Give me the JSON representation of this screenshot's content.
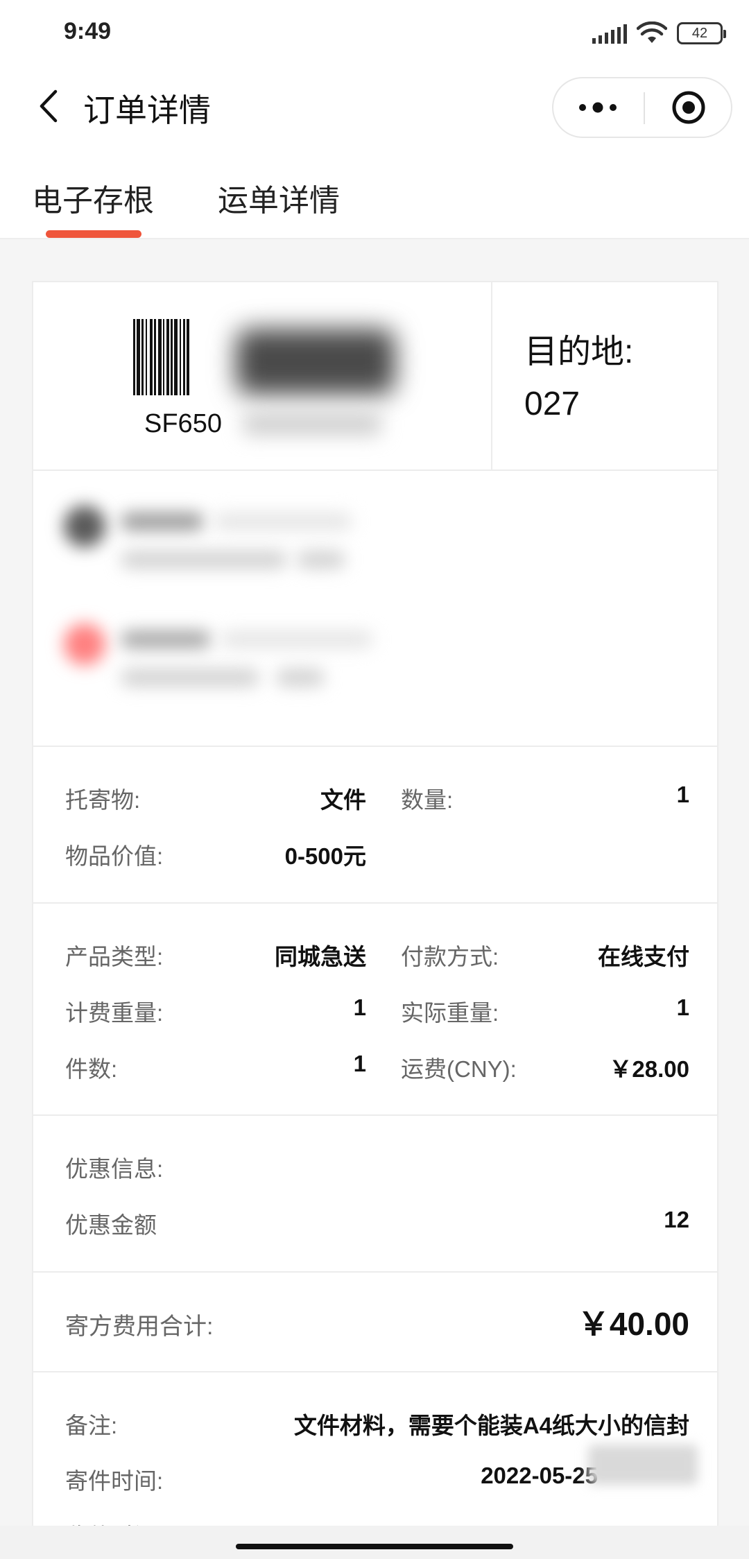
{
  "status_bar": {
    "time": "9:49",
    "battery": "42"
  },
  "nav": {
    "title": "订单详情"
  },
  "tabs": [
    {
      "label": "电子存根",
      "active": true
    },
    {
      "label": "运单详情",
      "active": false
    }
  ],
  "accent_color": "#ef553b",
  "stub": {
    "waybill_prefix": "SF650",
    "destination_label": "目的地:",
    "destination_code": "027"
  },
  "goods": {
    "item_label": "托寄物:",
    "item_value": "文件",
    "quantity_label": "数量:",
    "quantity_value": "1",
    "value_label": "物品价值:",
    "value_value": "0-500元"
  },
  "service": {
    "product_label": "产品类型:",
    "product_value": "同城急送",
    "payment_label": "付款方式:",
    "payment_value": "在线支付",
    "billing_weight_label": "计费重量:",
    "billing_weight_value": "1",
    "actual_weight_label": "实际重量:",
    "actual_weight_value": "1",
    "pieces_label": "件数:",
    "pieces_value": "1",
    "freight_label": "运费(CNY):",
    "freight_value": "￥28.00"
  },
  "discount": {
    "info_label": "优惠信息:",
    "amount_label": "优惠金额",
    "amount_value": "12"
  },
  "total": {
    "label": "寄方费用合计:",
    "value": "￥40.00"
  },
  "remarks": {
    "note_label": "备注:",
    "note_value": "文件材料，需要个能装A4纸大小的信封",
    "send_time_label": "寄件时间:",
    "send_time_value": "2022-05-25",
    "receive_time_label": "收件时间:"
  }
}
